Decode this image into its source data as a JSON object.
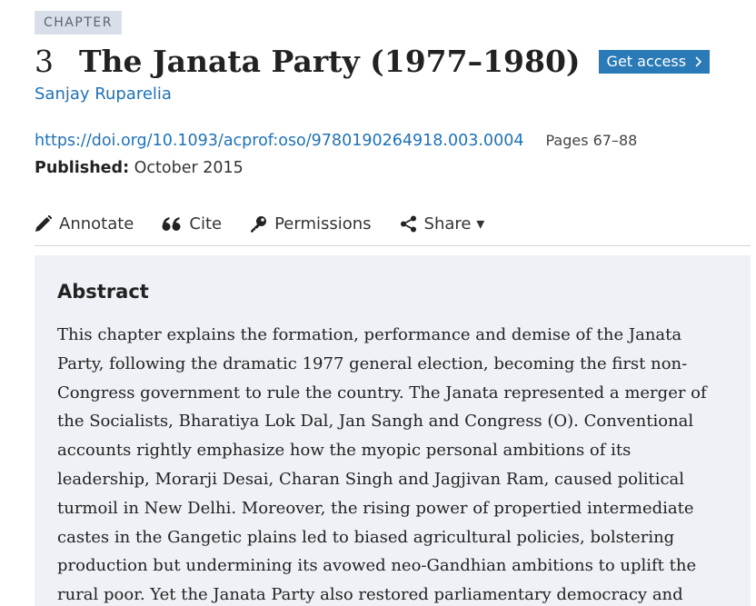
{
  "header": {
    "tag": "CHAPTER",
    "chapter_number": "3",
    "title": "The Janata Party (1977–1980)",
    "get_access_label": "Get access",
    "author": "Sanjay Ruparelia"
  },
  "meta": {
    "doi": "https://doi.org/10.1093/acprof:oso/9780190264918.003.0004",
    "pages": "Pages 67–88",
    "published_label": "Published:",
    "published_value": "October 2015"
  },
  "toolbar": {
    "annotate": {
      "label": "Annotate",
      "icon": "pencil-icon"
    },
    "cite": {
      "label": "Cite",
      "icon": "quote-icon"
    },
    "permissions": {
      "label": "Permissions",
      "icon": "key-icon"
    },
    "share": {
      "label": "Share ▾",
      "icon": "share-icon"
    }
  },
  "abstract": {
    "heading": "Abstract",
    "text": "This chapter explains the formation, performance and demise of the Janata Party, following the dramatic 1977 general election, becoming the first non-Congress government to rule the country. The Janata represented a merger of the Socialists, Bharatiya Lok Dal, Jan Sangh and Congress (O). Conventional accounts rightly emphasize how the myopic personal ambitions of its leadership, Morarji Desai, Charan Singh and Jagjivan Ram, caused political turmoil in New Delhi. Moreover, the rising power of propertied intermediate castes in the Gangetic plains led to biased agricultural policies, bolstering production but undermining its avowed neo-Gandhian ambitions to uplift the rural poor. Yet the Janata Party also restored parliamentary democracy and"
  },
  "colors": {
    "link": "#1f72b8",
    "button_bg": "#2a7ab7",
    "tag_bg": "#d9dfe9",
    "abstract_bg": "#eef1f6"
  }
}
